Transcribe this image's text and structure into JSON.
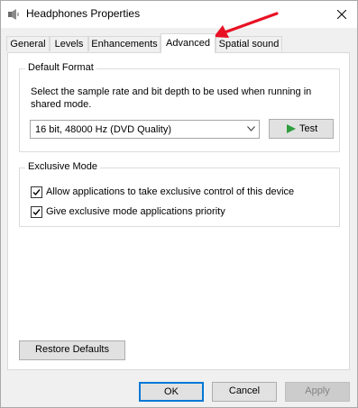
{
  "window": {
    "title": "Headphones Properties",
    "title_icon": "speaker-icon",
    "close_icon": "close-icon"
  },
  "tabs": [
    {
      "label": "General",
      "active": false
    },
    {
      "label": "Levels",
      "active": false
    },
    {
      "label": "Enhancements",
      "active": false
    },
    {
      "label": "Advanced",
      "active": true
    },
    {
      "label": "Spatial sound",
      "active": false
    }
  ],
  "default_format": {
    "legend": "Default Format",
    "description": "Select the sample rate and bit depth to be used when running in shared mode.",
    "selected_format": "16 bit, 48000 Hz (DVD Quality)",
    "test_label": "Test"
  },
  "exclusive_mode": {
    "legend": "Exclusive Mode",
    "options": [
      {
        "label": "Allow applications to take exclusive control of this device",
        "checked": true
      },
      {
        "label": "Give exclusive mode applications priority",
        "checked": true
      }
    ]
  },
  "restore_defaults_label": "Restore Defaults",
  "footer": {
    "ok_label": "OK",
    "cancel_label": "Cancel",
    "apply_label": "Apply",
    "apply_enabled": false
  },
  "annotation": {
    "arrow_color": "#e81123",
    "arrow_icon": "red-arrow-annotation"
  },
  "colors": {
    "accent": "#0078d7",
    "play_green": "#2e9e3e"
  }
}
